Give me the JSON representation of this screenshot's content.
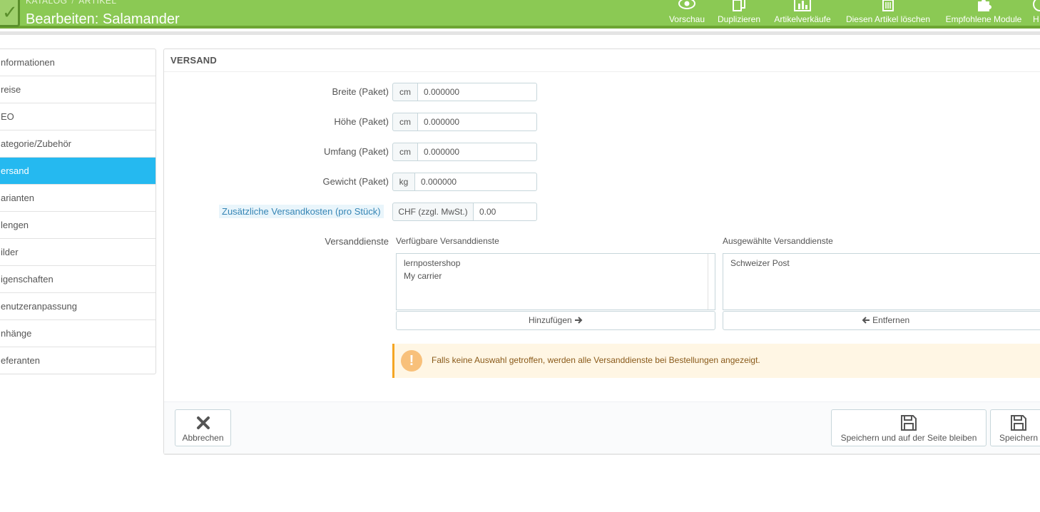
{
  "header": {
    "breadcrumb": [
      "KATALOG",
      "ARTIKEL"
    ],
    "breadcrumb_sep": "/",
    "title": "Bearbeiten: Salamander",
    "toolbar": [
      {
        "label": "Vorschau",
        "icon": "eye-icon"
      },
      {
        "label": "Duplizieren",
        "icon": "copy-icon"
      },
      {
        "label": "Artikelverkäufe",
        "icon": "bar-chart-icon"
      },
      {
        "label": "Diesen Artikel löschen",
        "icon": "trash-icon"
      },
      {
        "label": "Empfohlene Module",
        "icon": "puzzle-icon"
      },
      {
        "label": "H",
        "icon": "help-icon"
      }
    ]
  },
  "sidebar": {
    "items": [
      {
        "label": "nformationen"
      },
      {
        "label": "reise"
      },
      {
        "label": "EO"
      },
      {
        "label": "ategorie/Zubehör"
      },
      {
        "label": "ersand",
        "active": true
      },
      {
        "label": "arianten"
      },
      {
        "label": "lengen"
      },
      {
        "label": "ilder"
      },
      {
        "label": "igenschaften"
      },
      {
        "label": "enutzeranpassung"
      },
      {
        "label": "nhänge"
      },
      {
        "label": "eferanten"
      }
    ]
  },
  "panel": {
    "heading": "VERSAND",
    "fields": {
      "width": {
        "label": "Breite (Paket)",
        "unit": "cm",
        "value": "0.000000"
      },
      "height": {
        "label": "Höhe (Paket)",
        "unit": "cm",
        "value": "0.000000"
      },
      "depth": {
        "label": "Umfang (Paket)",
        "unit": "cm",
        "value": "0.000000"
      },
      "weight": {
        "label": "Gewicht (Paket)",
        "unit": "kg",
        "value": "0.000000"
      },
      "extra_cost": {
        "label": "Zusätzliche Versandkosten (pro Stück)",
        "unit": "CHF (zzgl. MwSt.)",
        "value": "0.00"
      }
    },
    "carriers": {
      "label": "Versanddienste",
      "available_title": "Verfügbare Versanddienste",
      "available": [
        "lernpostershop",
        "My carrier"
      ],
      "selected_title": "Ausgewählte Versanddienste",
      "selected": [
        "Schweizer Post"
      ],
      "add_label": "Hinzufügen",
      "remove_label": "Entfernen"
    },
    "alert": {
      "icon": "!",
      "text": "Falls keine Auswahl getroffen, werden alle Versanddienste bei Bestellungen angezeigt."
    },
    "footer": {
      "cancel_label": "Abbrechen",
      "save_stay_label": "Speichern und auf der Seite bleiben",
      "save_label": "Speichern"
    }
  },
  "colors": {
    "header_bg": "#8bc954",
    "active_tab": "#25b9f0",
    "alert_bg": "#fff6e4"
  }
}
